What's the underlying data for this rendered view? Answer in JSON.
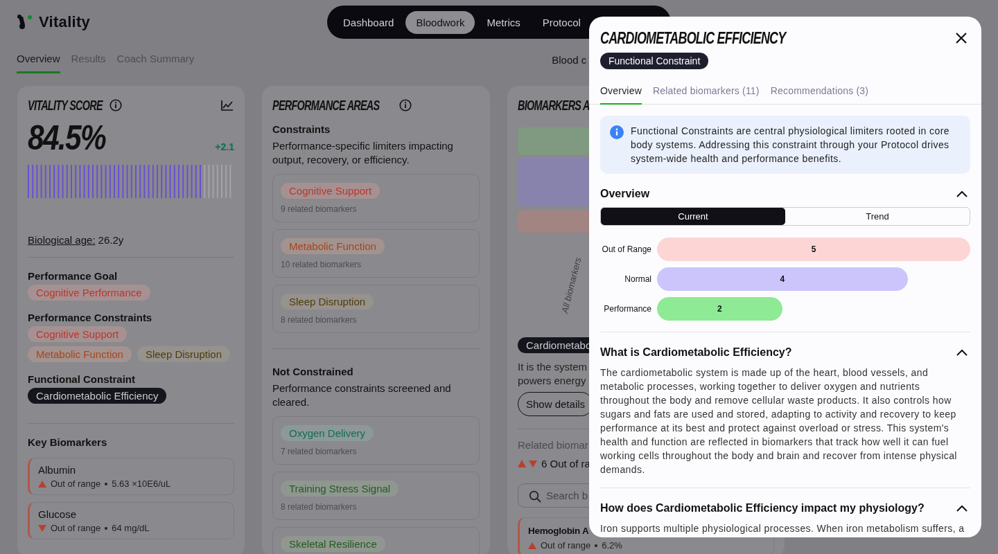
{
  "brand": {
    "name": "Vitality"
  },
  "nav": [
    {
      "label": "Dashboard",
      "selected": false
    },
    {
      "label": "Bloodwork",
      "selected": true
    },
    {
      "label": "Metrics",
      "selected": false
    },
    {
      "label": "Protocol",
      "selected": false
    }
  ],
  "subtabs": [
    {
      "label": "Overview",
      "selected": true
    },
    {
      "label": "Results",
      "selected": false
    },
    {
      "label": "Coach Summary",
      "selected": false
    }
  ],
  "subtab_right": "Blood c",
  "vitality": {
    "title": "VITALITY SCORE",
    "score": "84.5%",
    "delta": "+2.1",
    "level": 0.845,
    "bio_age_label": "Biological age:",
    "bio_age": "26.2y",
    "goal_heading": "Performance Goal",
    "goals": [
      {
        "label": "Cognitive Performance",
        "color": "#b8372c"
      }
    ],
    "constraints_heading": "Performance Constraints",
    "constraints": [
      {
        "label": "Cognitive Support",
        "color": "#b8372c"
      },
      {
        "label": "Metabolic Function",
        "color": "#a4461c"
      },
      {
        "label": "Sleep Disruption",
        "color": "#4f3d0c"
      }
    ],
    "functional_heading": "Functional Constraint",
    "functional": [
      {
        "label": "Cardiometabolic Efficiency",
        "color": "#15151e"
      }
    ],
    "biomarkers_heading": "Key Biomarkers",
    "biomarkers": [
      {
        "name": "Albumin",
        "kind": "high",
        "status": "Out of range",
        "value": "5.63 ×10E6/uL"
      },
      {
        "name": "Glucose",
        "kind": "low",
        "status": "Out of range",
        "value": "64 mg/dL"
      }
    ]
  },
  "areas": {
    "title": "PERFORMANCE AREAS",
    "constrained_heading": "Constraints",
    "constrained_text": "Performance-specific limiters impacting output, recovery, or efficiency.",
    "constrained": [
      {
        "label": "Cognitive Support",
        "color": "#b8372c",
        "count": "9 related biomarkers"
      },
      {
        "label": "Metabolic Function",
        "color": "#a4461c",
        "count": "10 related biomarkers"
      },
      {
        "label": "Sleep Disruption",
        "color": "#4f3d0c",
        "count": "8 related biomarkers"
      }
    ],
    "clear_heading": "Not Constrained",
    "clear_text": "Performance constraints screened and cleared.",
    "clear": [
      {
        "label": "Oxygen Delivery",
        "color": "#146b55",
        "count": "7 related biomarkers"
      },
      {
        "label": "Training Stress Signal",
        "color": "#235c1e",
        "count": "8 related biomarkers"
      },
      {
        "label": "Skeletal Resilience",
        "color": "#235c1e"
      }
    ]
  },
  "biomarkers": {
    "title": "BIOMARKERS A",
    "axis_label": "All biomarkers",
    "chip": "Cardiometabo",
    "text_lines": [
      "It is the system",
      "powers energy"
    ],
    "button": "Show details",
    "related": "Related biomar",
    "out_of_range": "6 Out of ra",
    "search": {
      "placeholder": "Search b"
    },
    "rows": [
      {
        "name": "Hemoglobin A",
        "kind": "high",
        "status": "Out of range",
        "value": "6.2%"
      }
    ]
  },
  "modal": {
    "title": "CARDIOMETABOLIC EFFICIENCY",
    "badge": "Functional Constraint",
    "tabs": [
      {
        "label": "Overview",
        "selected": true
      },
      {
        "label": "Related biomarkers (11)",
        "selected": false
      },
      {
        "label": "Recommendations (3)",
        "selected": false
      }
    ],
    "info": "Functional Constraints are central physiological limiters rooted in core body systems. Addressing this constraint through your Protocol drives system-wide health and performance benefits.",
    "overview": {
      "heading": "Overview",
      "expanded": true,
      "segments": [
        {
          "label": "Current",
          "selected": true
        },
        {
          "label": "Trend",
          "selected": false
        }
      ],
      "chart_data": {
        "type": "bar",
        "orientation": "horizontal",
        "data_labels": true,
        "series": [
          {
            "name": "Out of Range",
            "color": "#fdd5d5",
            "values": [
              5
            ]
          },
          {
            "name": "Normal",
            "color": "#cbc5fb",
            "values": [
              4
            ]
          },
          {
            "name": "Performance",
            "color": "#8eea95",
            "values": [
              2
            ]
          }
        ]
      }
    },
    "sections": [
      {
        "heading": "What is Cardiometabolic Efficiency?",
        "expanded": true,
        "body": "The cardiometabolic system is made up of the heart, blood vessels, and metabolic processes, working together to deliver oxygen and nutrients throughout the body and remove cellular waste products. It also controls how sugars and fats are used and stored, adapting to activity and recovery to keep performance at its best and protect against overload or stress. This system's health and function are reflected in biomarkers that track how well it can fuel working cells throughout the body and brain and recover from intense physical demands."
      },
      {
        "heading": "How does Cardiometabolic Efficiency impact my physiology?",
        "expanded": true,
        "body": "Iron supports multiple physiological processes. When iron metabolism suffers, a"
      }
    ]
  }
}
